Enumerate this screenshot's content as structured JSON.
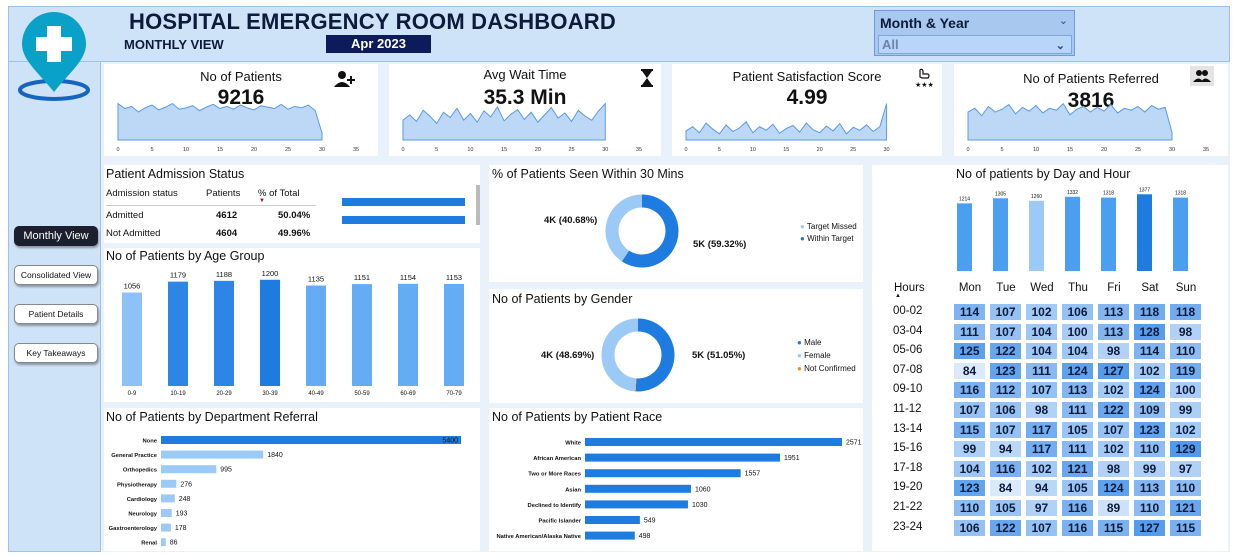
{
  "header": {
    "title": "HOSPITAL EMERGENCY ROOM DASHBOARD",
    "subtitle": "MONTHLY VIEW",
    "period": "Apr 2023",
    "slicer_label": "Month & Year",
    "slicer_value": "All"
  },
  "nav": {
    "monthly": "Monthly View",
    "consolidated": "Consolidated View",
    "patient_details": "Patient Details",
    "key_takeaways": "Key Takeaways"
  },
  "kpis": [
    {
      "title": "No of Patients",
      "value": "9216",
      "icon": "add-user-icon",
      "spark": [
        52,
        45,
        48,
        40,
        46,
        50,
        43,
        47,
        52,
        44,
        46,
        49,
        42,
        47,
        51,
        45,
        48,
        44,
        50,
        46,
        43,
        49,
        47,
        45,
        51,
        44,
        48,
        46,
        50,
        42,
        10
      ],
      "ticks": [
        "0",
        "5",
        "10",
        "15",
        "20",
        "25",
        "30",
        "35"
      ]
    },
    {
      "title": "Avg Wait Time",
      "value": "35.3 Min",
      "icon": "hourglass-icon",
      "spark": [
        30,
        38,
        28,
        45,
        36,
        25,
        42,
        34,
        48,
        30,
        40,
        27,
        44,
        35,
        50,
        29,
        39,
        46,
        31,
        42,
        27,
        38,
        49,
        33,
        41,
        28,
        45,
        36,
        30,
        44,
        55
      ],
      "ticks": [
        "0",
        "5",
        "10",
        "15",
        "20",
        "25",
        "30",
        "35"
      ]
    },
    {
      "title": "Patient Satisfaction Score",
      "value": "4.99",
      "icon": "rating-icon",
      "spark": [
        15,
        22,
        12,
        28,
        18,
        10,
        25,
        14,
        20,
        30,
        12,
        22,
        16,
        26,
        11,
        19,
        24,
        13,
        28,
        17,
        12,
        23,
        15,
        27,
        10,
        21,
        16,
        25,
        14,
        22,
        60
      ],
      "ticks": [
        "0",
        "5",
        "10",
        "15",
        "20",
        "25",
        "30"
      ]
    },
    {
      "title": "No of Patients Referred",
      "value": "3816",
      "icon": "group-icon",
      "spark": [
        30,
        34,
        26,
        36,
        30,
        33,
        38,
        28,
        35,
        31,
        37,
        29,
        34,
        32,
        39,
        27,
        33,
        36,
        30,
        35,
        31,
        38,
        29,
        34,
        32,
        36,
        30,
        37,
        33,
        35,
        8
      ],
      "ticks": [
        "0",
        "5",
        "10",
        "15",
        "20",
        "25",
        "30",
        "35"
      ]
    }
  ],
  "admission": {
    "title": "Patient Admission Status",
    "headers": [
      "Admission status",
      "Patients",
      "% of Total"
    ],
    "rows": [
      {
        "status": "Admitted",
        "patients": "4612",
        "pct": "50.04%",
        "share": 0.5004
      },
      {
        "status": "Not Admitted",
        "patients": "4604",
        "pct": "49.96%",
        "share": 0.4996
      }
    ]
  },
  "age_group": {
    "title": "No of Patients by Age Group",
    "chart_data": {
      "type": "bar",
      "categories": [
        "0-9",
        "10-19",
        "20-29",
        "30-39",
        "40-49",
        "50-59",
        "60-69",
        "70-79"
      ],
      "values": [
        1056,
        1179,
        1188,
        1200,
        1135,
        1151,
        1154,
        1153
      ]
    }
  },
  "seen30": {
    "title": "% of Patients Seen Within 30 Mins",
    "left_label": "4K (40.68%)",
    "right_label": "5K (59.32%)",
    "legend": [
      "Target Missed",
      "Within Target"
    ],
    "chart_data": {
      "type": "pie",
      "categories": [
        "Target Missed",
        "Within Target"
      ],
      "values": [
        40.68,
        59.32
      ]
    }
  },
  "gender": {
    "title": "No of Patients by Gender",
    "left_label": "4K (48.69%)",
    "right_label": "5K (51.05%)",
    "legend": [
      "Male",
      "Female",
      "Not Confirmed"
    ],
    "chart_data": {
      "type": "pie",
      "categories": [
        "Male",
        "Female",
        "Not Confirmed"
      ],
      "values": [
        51.05,
        48.69,
        0.26
      ]
    }
  },
  "department": {
    "title": "No of Patients by Department Referral",
    "chart_data": {
      "type": "bar",
      "categories": [
        "None",
        "General Practice",
        "Orthopedics",
        "Physiotherapy",
        "Cardiology",
        "Neurology",
        "Gastroenterology",
        "Renal"
      ],
      "values": [
        5400,
        1840,
        995,
        276,
        248,
        193,
        178,
        86
      ]
    }
  },
  "race": {
    "title": "No of Patients by Patient Race",
    "chart_data": {
      "type": "bar",
      "categories": [
        "White",
        "African American",
        "Two or More Races",
        "Asian",
        "Declined to Identify",
        "Pacific Islander",
        "Native American/Alaska Native"
      ],
      "values": [
        2571,
        1951,
        1557,
        1060,
        1030,
        549,
        498
      ]
    }
  },
  "dayhour": {
    "title": "No of patients by Day and Hour",
    "hours_label": "Hours",
    "chart_data": {
      "type": "bar",
      "categories": [
        "Mon",
        "Tue",
        "Wed",
        "Thu",
        "Fri",
        "Sat",
        "Sun"
      ],
      "values": [
        1214,
        1305,
        1260,
        1332,
        1318,
        1377,
        1318
      ]
    },
    "day_totals_labels": [
      "1214",
      "1305",
      "1260",
      "1332",
      "1318",
      "1377",
      "1318"
    ],
    "hours": [
      "00-02",
      "03-04",
      "05-06",
      "07-08",
      "09-10",
      "11-12",
      "13-14",
      "15-16",
      "17-18",
      "19-20",
      "21-22",
      "23-24"
    ],
    "grid": [
      [
        114,
        107,
        102,
        106,
        113,
        118,
        118
      ],
      [
        111,
        107,
        104,
        100,
        113,
        128,
        98
      ],
      [
        125,
        122,
        104,
        104,
        98,
        114,
        110
      ],
      [
        84,
        123,
        111,
        124,
        127,
        102,
        119
      ],
      [
        116,
        112,
        107,
        113,
        102,
        124,
        100
      ],
      [
        107,
        106,
        98,
        111,
        122,
        109,
        99
      ],
      [
        115,
        107,
        117,
        105,
        107,
        123,
        102
      ],
      [
        99,
        94,
        117,
        111,
        102,
        110,
        129
      ],
      [
        104,
        116,
        102,
        121,
        98,
        99,
        97
      ],
      [
        123,
        84,
        94,
        105,
        124,
        113,
        110
      ],
      [
        110,
        105,
        97,
        116,
        89,
        110,
        121
      ],
      [
        106,
        122,
        107,
        116,
        115,
        127,
        115
      ]
    ]
  },
  "colors": {
    "primary": "#1e7be0",
    "light": "#7fb8f5",
    "pale": "#c9e0fa",
    "dark": "#0d1b5a"
  }
}
